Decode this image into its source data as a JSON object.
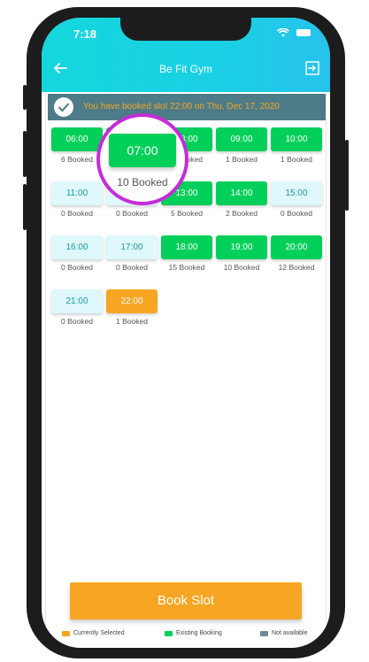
{
  "status_bar": {
    "time": "7:18"
  },
  "header": {
    "title": "Be Fit Gym"
  },
  "banner": {
    "text": "You have booked slot 22:00 on Thu, Dec 17, 2020"
  },
  "slots": [
    {
      "time": "06:00",
      "count": "6 Booked",
      "state": "booked"
    },
    {
      "time": "07:00",
      "count": "10 Booked",
      "state": "booked"
    },
    {
      "time": "08:00",
      "count": "6 Booked",
      "state": "booked"
    },
    {
      "time": "09:00",
      "count": "1 Booked",
      "state": "booked"
    },
    {
      "time": "10:00",
      "count": "1 Booked",
      "state": "booked"
    },
    {
      "time": "11:00",
      "count": "0 Booked",
      "state": "available"
    },
    {
      "time": "12:00",
      "count": "0 Booked",
      "state": "available"
    },
    {
      "time": "13:00",
      "count": "5 Booked",
      "state": "booked"
    },
    {
      "time": "14:00",
      "count": "2 Booked",
      "state": "booked"
    },
    {
      "time": "15:00",
      "count": "0 Booked",
      "state": "available"
    },
    {
      "time": "16:00",
      "count": "0 Booked",
      "state": "available"
    },
    {
      "time": "17:00",
      "count": "0 Booked",
      "state": "available"
    },
    {
      "time": "18:00",
      "count": "15 Booked",
      "state": "booked"
    },
    {
      "time": "19:00",
      "count": "10 Booked",
      "state": "booked"
    },
    {
      "time": "20:00",
      "count": "12 Booked",
      "state": "booked"
    },
    {
      "time": "21:00",
      "count": "0 Booked",
      "state": "available"
    },
    {
      "time": "22:00",
      "count": "1 Booked",
      "state": "selected"
    }
  ],
  "zoom": {
    "time": "07:00",
    "count": "10 Booked"
  },
  "book_button": {
    "label": "Book Slot"
  },
  "legend": {
    "selected": "Currently Selected",
    "existing": "Existing Booking",
    "unavailable": "Not available"
  },
  "colors": {
    "header": "#1ad0e4",
    "booked": "#00cf5a",
    "available": "#dff8fb",
    "selected": "#f6a623",
    "banner": "#4d7b88",
    "highlight_circle": "#c72bd9",
    "not_available": "#6f8a96"
  },
  "icons": {
    "back": "arrow-left-icon",
    "exit": "exit-icon",
    "check": "check-circle-icon"
  }
}
